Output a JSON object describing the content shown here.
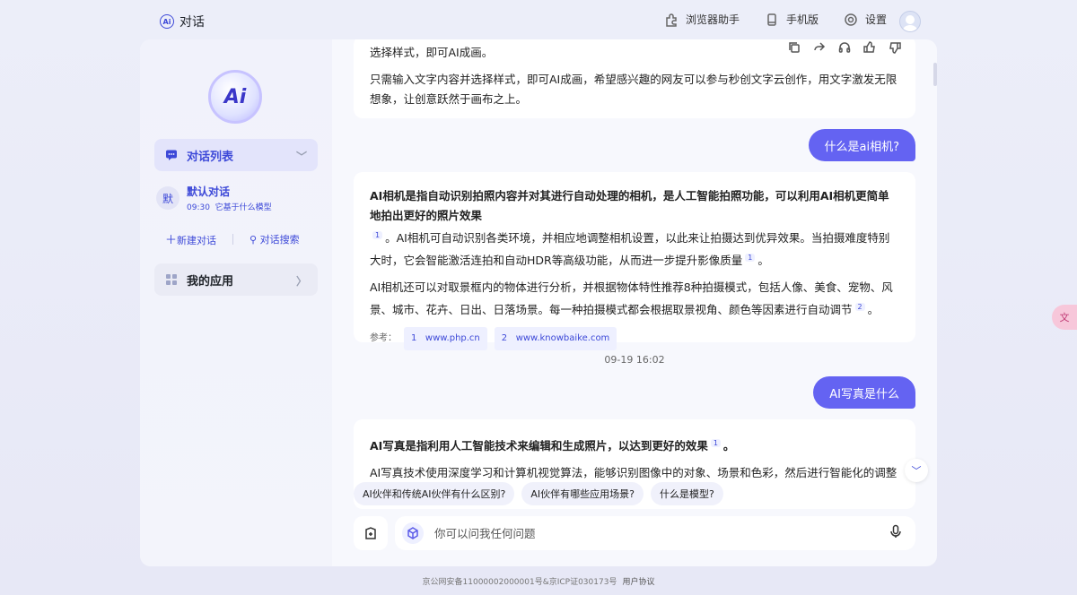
{
  "topbar": {
    "brand_logo": "Ai",
    "title": "对话",
    "nav": [
      {
        "label": "浏览器助手",
        "icon": "puzzle-icon"
      },
      {
        "label": "手机版",
        "icon": "phone-icon"
      },
      {
        "label": "设置",
        "icon": "gear-icon"
      }
    ]
  },
  "sidebar": {
    "logo": "Ai",
    "conversation_list_label": "对话列表",
    "conversation": {
      "avatar": "默",
      "title": "默认对话",
      "time": "09:30",
      "subtitle": "它基于什么模型"
    },
    "new_chat_label": "新建对话",
    "search_label": "对话搜索",
    "my_apps_label": "我的应用"
  },
  "chat": {
    "msg0_line1": "选择样式，即可AI成画。",
    "msg0_p2": "只需输入文字内容并选择样式，即可AI成画，希望感兴趣的网友可以参与秒创文字云创作，用文字激发无限想象，让创意跃然于画布之上。",
    "user_q1": "什么是ai相机?",
    "msg1_bold": "AI相机是指自动识别拍照内容并对其进行自动处理的相机，是人工智能拍照功能，可以利用AI相机更简单地拍出更好的照片效果",
    "msg1_ref_a": "1",
    "msg1_text1": "。AI相机可自动识别各类环境，并相应地调整相机设置，以此来让拍摄达到优异效果。当拍摄难度特别大时，它会智能激活连拍和自动HDR等高级功能，从而进一步提升影像质量",
    "msg1_ref_b": "1",
    "msg1_end1": "。",
    "msg1_p2": "AI相机还可以对取景框内的物体进行分析，并根据物体特性推荐8种拍摄模式，包括人像、美食、宠物、风景、城市、花卉、日出、日落场景。每一种拍摄模式都会根据取景视角、颜色等因素进行自动调节",
    "msg1_ref_c": "2",
    "msg1_end2": "。",
    "refs_label": "参考：",
    "refs": [
      {
        "num": "1",
        "site": "www.php.cn"
      },
      {
        "num": "2",
        "site": "www.knowbaike.com"
      }
    ],
    "timestamp": "09-19 16:02",
    "user_q2": "AI写真是什么",
    "msg2_bold": "AI写真是指利用人工智能技术来编辑和生成照片，以达到更好的效果",
    "msg2_ref": "1",
    "msg2_end": "。",
    "msg2_p2": "AI写真技术使用深度学习和计算机视觉算法，能够识别图像中的对象、场景和色彩，然后进行智能化的调整"
  },
  "suggestions": [
    "AI伙伴和传统AI伙伴有什么区别?",
    "AI伙伴有哪些应用场景?",
    "什么是模型?"
  ],
  "input": {
    "placeholder": "你可以问我任何问题"
  },
  "footer": {
    "text": "京公网安备11000002000001号&京ICP证030173号",
    "link": "用户协议"
  },
  "accent_color": "#6463f2"
}
